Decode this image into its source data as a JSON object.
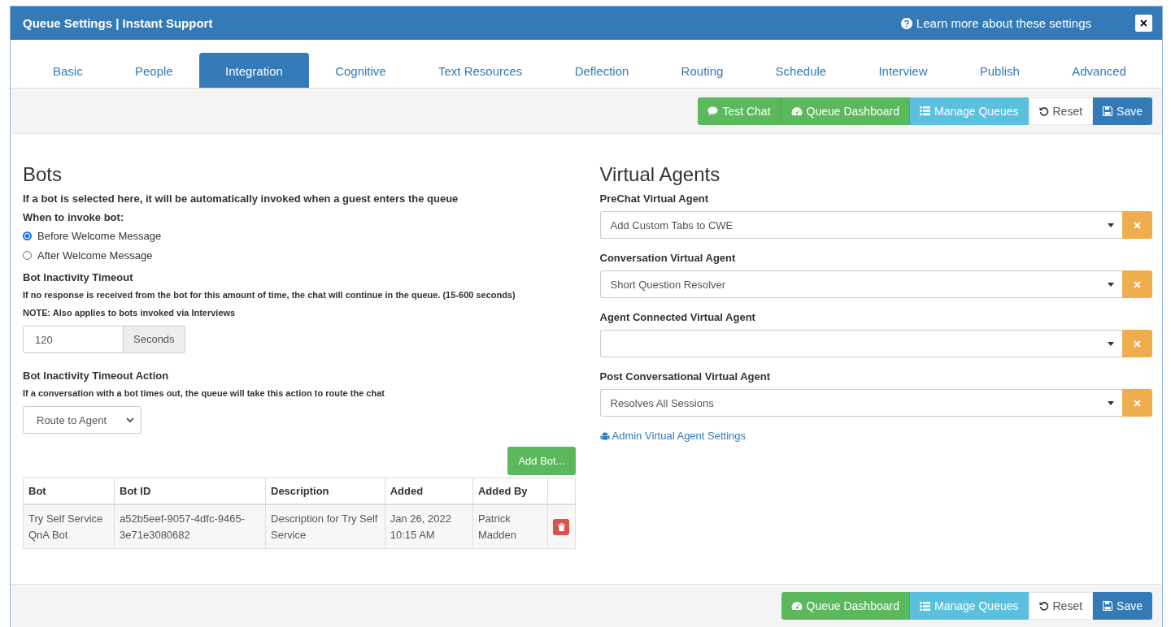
{
  "window": {
    "title": "Queue Settings | Instant Support",
    "help_link": "Learn more about these settings",
    "close": "×"
  },
  "tabs": [
    {
      "label": "Basic",
      "selected": false
    },
    {
      "label": "People",
      "selected": false
    },
    {
      "label": "Integration",
      "selected": true
    },
    {
      "label": "Cognitive",
      "selected": false
    },
    {
      "label": "Text Resources",
      "selected": false
    },
    {
      "label": "Deflection",
      "selected": false
    },
    {
      "label": "Routing",
      "selected": false
    },
    {
      "label": "Schedule",
      "selected": false
    },
    {
      "label": "Interview",
      "selected": false
    },
    {
      "label": "Publish",
      "selected": false
    },
    {
      "label": "Advanced",
      "selected": false
    }
  ],
  "top_toolbar": [
    {
      "kind": "chat",
      "label": "Test Chat"
    },
    {
      "kind": "dashboard",
      "label": "Queue Dashboard"
    },
    {
      "kind": "manage",
      "label": "Manage Queues"
    },
    {
      "kind": "reset",
      "label": "Reset"
    },
    {
      "kind": "save",
      "label": "Save"
    }
  ],
  "bots": {
    "title": "Bots",
    "intro": "If a bot is selected here, it will be automatically invoked when a guest enters the queue",
    "invoke_label": "When to invoke bot:",
    "invoke_options": [
      {
        "label": "Before Welcome Message",
        "selected": true
      },
      {
        "label": "After Welcome Message",
        "selected": false
      }
    ],
    "timeout_title": "Bot Inactivity Timeout",
    "timeout_help": "If no response is received from the bot for this amount of time, the chat will continue in the queue. (15-600 seconds)",
    "timeout_note": "NOTE: Also applies to bots invoked via Interviews",
    "timeout_value": "120",
    "timeout_unit": "Seconds",
    "action_title": "Bot Inactivity Timeout Action",
    "action_help": "If a conversation with a bot times out, the queue will take this action to route the chat",
    "action_value": "Route to Agent",
    "add_button": "Add Bot...",
    "table": {
      "columns": [
        "Bot",
        "Bot ID",
        "Description",
        "Added",
        "Added By"
      ],
      "rows": [
        {
          "cells": [
            "Try Self Service QnA Bot",
            "a52b5eef-9057-4dfc-9465-3e71e3080682",
            "Description for Try Self Service",
            "Jan 26, 2022 10:15 AM",
            "Patrick Madden"
          ]
        }
      ]
    }
  },
  "virtual_agents": {
    "title": "Virtual Agents",
    "fields": [
      {
        "label": "PreChat Virtual Agent",
        "value": "Add Custom Tabs to CWE"
      },
      {
        "label": "Conversation Virtual Agent",
        "value": "Short Question Resolver"
      },
      {
        "label": "Agent Connected Virtual Agent"
      },
      {
        "label": "Post Conversational Virtual Agent",
        "value": "Resolves All Sessions"
      }
    ],
    "admin_link": "Admin Virtual Agent Settings"
  },
  "bottom_toolbar": [
    {
      "kind": "dashboard",
      "label": "Queue Dashboard"
    },
    {
      "kind": "manage",
      "label": "Manage Queues"
    },
    {
      "kind": "reset",
      "label": "Reset"
    },
    {
      "kind": "save",
      "label": "Save"
    }
  ]
}
